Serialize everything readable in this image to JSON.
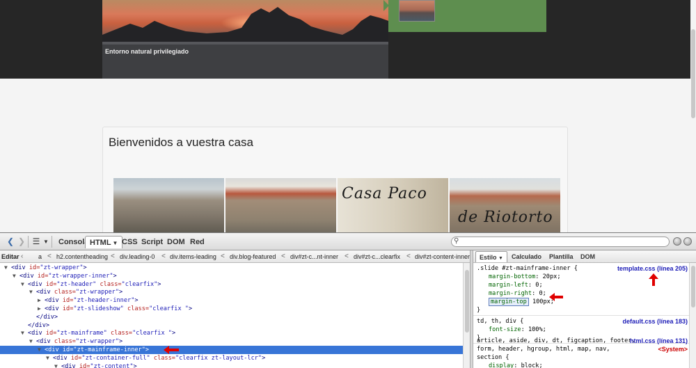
{
  "site": {
    "slide_caption": "Entorno natural privilegiado",
    "content_title": "Bienvenidos a vuestra casa",
    "logo_line1": "Casa Paco",
    "logo_line2": "de Riotorto"
  },
  "firebug": {
    "tabs": [
      "Consola",
      "HTML",
      "CSS",
      "Script",
      "DOM",
      "Red"
    ],
    "active_tab": "HTML",
    "search_value": "",
    "edit_label": "Editar",
    "breadcrumbs": [
      "a",
      "h2.contentheading",
      "div.leading-0",
      "div.items-leading",
      "div.blog-featured",
      "div#zt-c...nt-inner",
      "div#zt-c...clearfix",
      "div#zt-content-inner"
    ],
    "side_tabs": [
      "Estilo",
      "Calculado",
      "Plantilla",
      "DOM"
    ],
    "tree": [
      {
        "indent": 0,
        "tw": "▼",
        "tag": "div",
        "attrs": [
          [
            "id",
            "zt-wrapper"
          ]
        ],
        "close": ">"
      },
      {
        "indent": 1,
        "tw": "▼",
        "tag": "div",
        "attrs": [
          [
            "id",
            "zt-wrapper-inner"
          ]
        ],
        "close": ">"
      },
      {
        "indent": 2,
        "tw": "▼",
        "tag": "div",
        "attrs": [
          [
            "id",
            "zt-header"
          ],
          [
            "class",
            "clearfix"
          ]
        ],
        "close": ">"
      },
      {
        "indent": 3,
        "tw": "▼",
        "tag": "div",
        "attrs": [
          [
            "class",
            "zt-wrapper"
          ]
        ],
        "close": ">"
      },
      {
        "indent": 4,
        "tw": "▶",
        "tag": "div",
        "attrs": [
          [
            "id",
            "zt-header-inner"
          ]
        ],
        "close": ">"
      },
      {
        "indent": 4,
        "tw": "▶",
        "tag": "div",
        "attrs": [
          [
            "id",
            "zt-slideshow"
          ],
          [
            "class",
            "clearfix "
          ]
        ],
        "close": ">"
      },
      {
        "indent": 3,
        "tw": "",
        "tag": "/div",
        "attrs": [],
        "close": ">"
      },
      {
        "indent": 2,
        "tw": "",
        "tag": "/div",
        "attrs": [],
        "close": ">"
      },
      {
        "indent": 2,
        "tw": "▼",
        "tag": "div",
        "attrs": [
          [
            "id",
            "zt-mainframe"
          ],
          [
            "class",
            "clearfix "
          ]
        ],
        "close": ">"
      },
      {
        "indent": 3,
        "tw": "▼",
        "tag": "div",
        "attrs": [
          [
            "class",
            "zt-wrapper"
          ]
        ],
        "close": ">"
      },
      {
        "indent": 4,
        "tw": "▼",
        "tag": "div",
        "attrs": [
          [
            "id",
            "zt-mainframe-inner"
          ]
        ],
        "close": ">",
        "selected": true
      },
      {
        "indent": 5,
        "tw": "▼",
        "tag": "div",
        "attrs": [
          [
            "id",
            "zt-container-full"
          ],
          [
            "class",
            "clearfix zt-layout-lcr"
          ]
        ],
        "close": ">"
      },
      {
        "indent": 6,
        "tw": "▼",
        "tag": "div",
        "attrs": [
          [
            "id",
            "zt-content"
          ]
        ],
        "close": ">"
      }
    ],
    "rules": [
      {
        "selector": ".slide #zt-mainframe-inner {",
        "source": "template.css (línea 205)",
        "props": [
          {
            "name": "margin-bottom",
            "value": "20px;"
          },
          {
            "name": "margin-left",
            "value": "0;"
          },
          {
            "name": "margin-right",
            "value": "0;"
          },
          {
            "name": "margin-top",
            "value": "100px;",
            "highlight": true
          }
        ]
      },
      {
        "selector": "td, th, div {",
        "source": "default.css (línea 183)",
        "props": [
          {
            "name": "font-size",
            "value": "100%;"
          }
        ]
      },
      {
        "selector": "article, aside, div, dt, figcaption, footer,",
        "selector2": "form, header, hgroup, html, map, nav,",
        "selector3": "section {",
        "source": "html.css (línea 131)",
        "source2": "<System>",
        "props": [
          {
            "name": "display",
            "value": "block;"
          }
        ]
      }
    ]
  },
  "colors": {
    "selection": "#3875d7",
    "annotation_arrow": "#e00000",
    "link": "#1c1cb7"
  }
}
